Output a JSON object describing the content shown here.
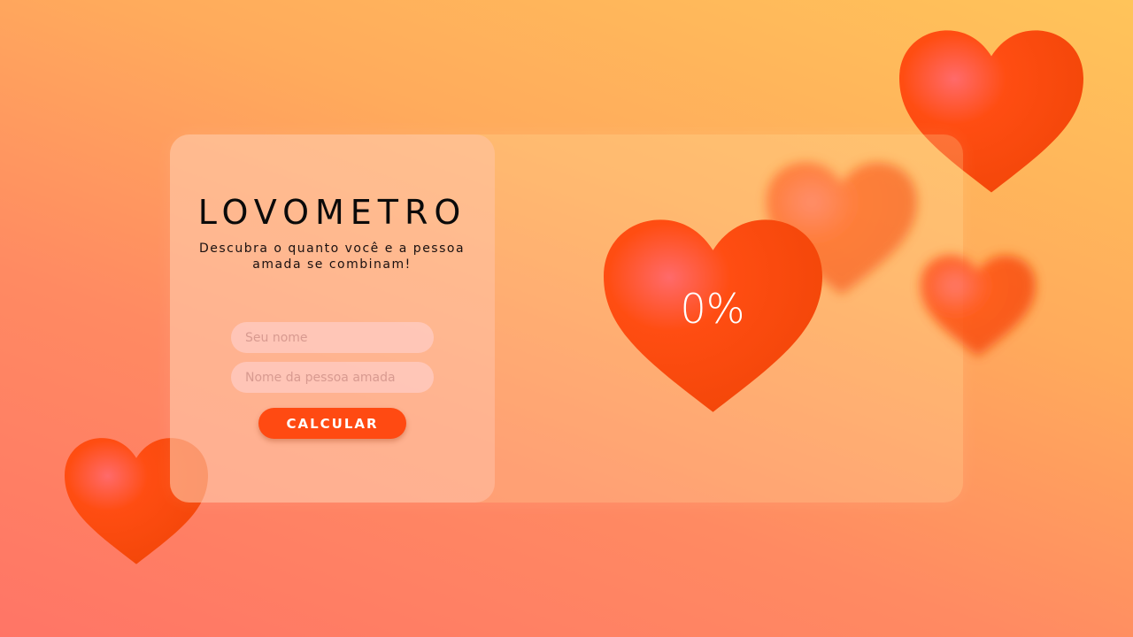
{
  "app": {
    "title": "LOVOMETRO",
    "subtitle": "Descubra o quanto você e a pessoa amada se combinam!"
  },
  "form": {
    "name_placeholder": "Seu nome",
    "partner_placeholder": "Nome da pessoa amada",
    "calculate_label": "CALCULAR"
  },
  "result": {
    "percentage": "0%"
  },
  "colors": {
    "accent": "#ff4a12",
    "heart": "#ff4d12"
  }
}
